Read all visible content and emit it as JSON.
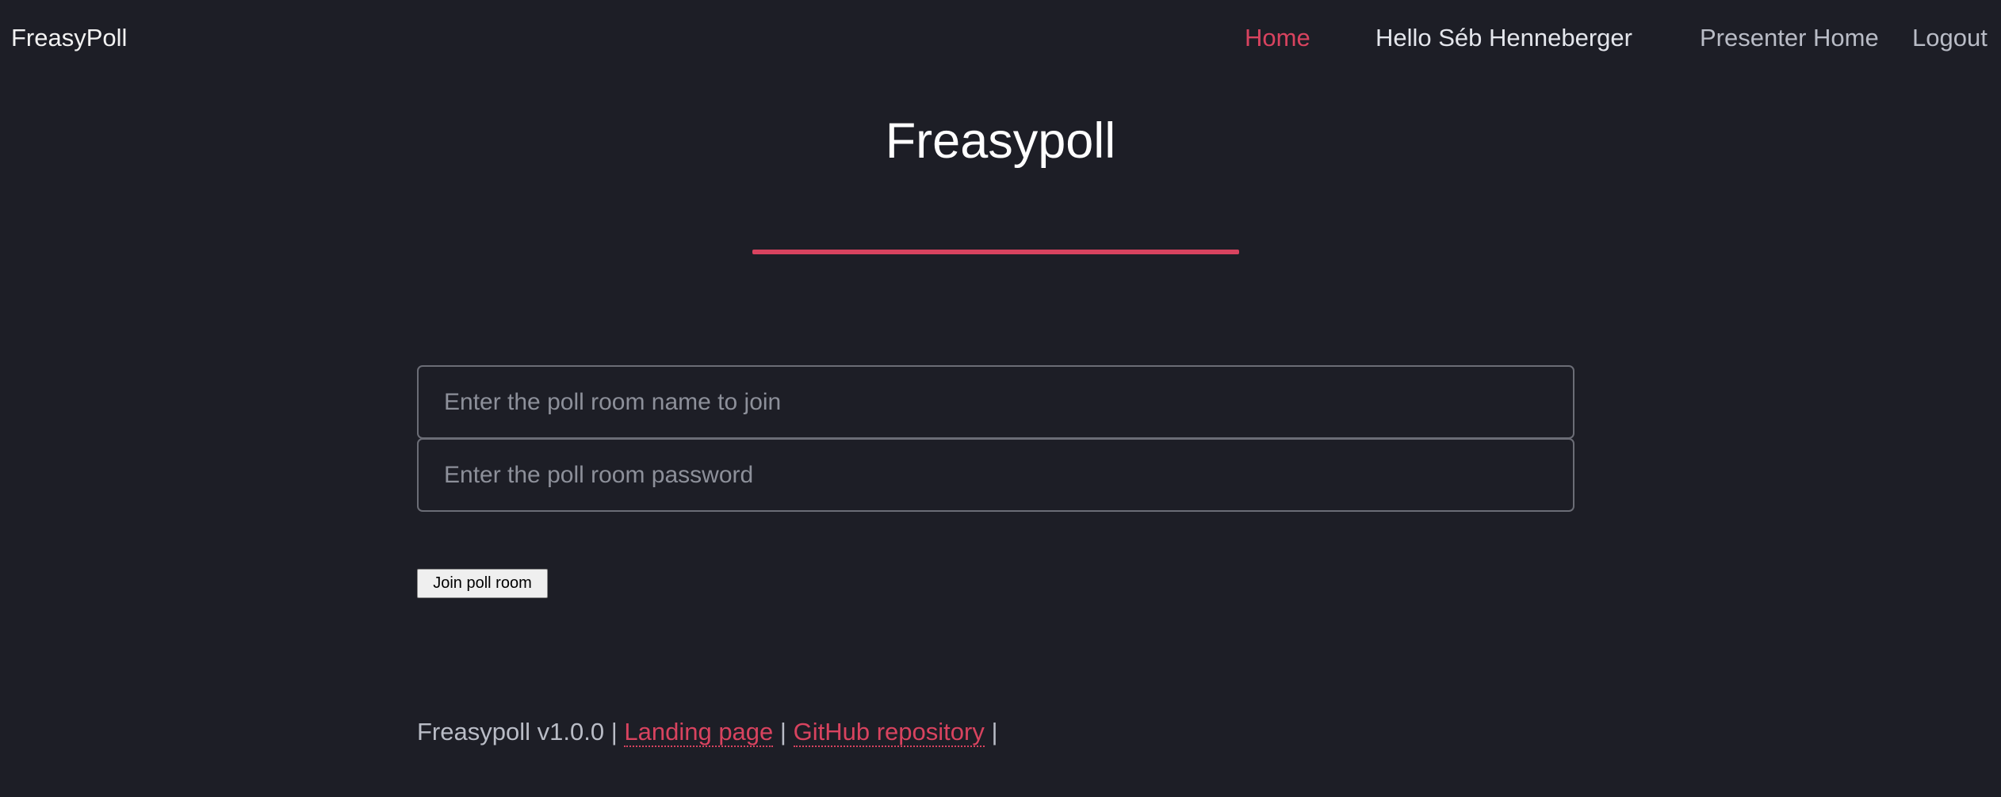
{
  "navbar": {
    "brand": "FreasyPoll",
    "home": "Home",
    "greeting": "Hello Séb Henneberger",
    "presenter_home": "Presenter Home",
    "logout": "Logout"
  },
  "main": {
    "title": "Freasypoll",
    "room_name_placeholder": "Enter the poll room name to join",
    "room_password_placeholder": "Enter the poll room password",
    "join_button": "Join poll room"
  },
  "footer": {
    "version": "Freasypoll v1.0.0",
    "separator": "|",
    "landing_page": "Landing page",
    "github": "GitHub repository"
  },
  "colors": {
    "background": "#1d1e26",
    "accent": "#d8435f"
  }
}
